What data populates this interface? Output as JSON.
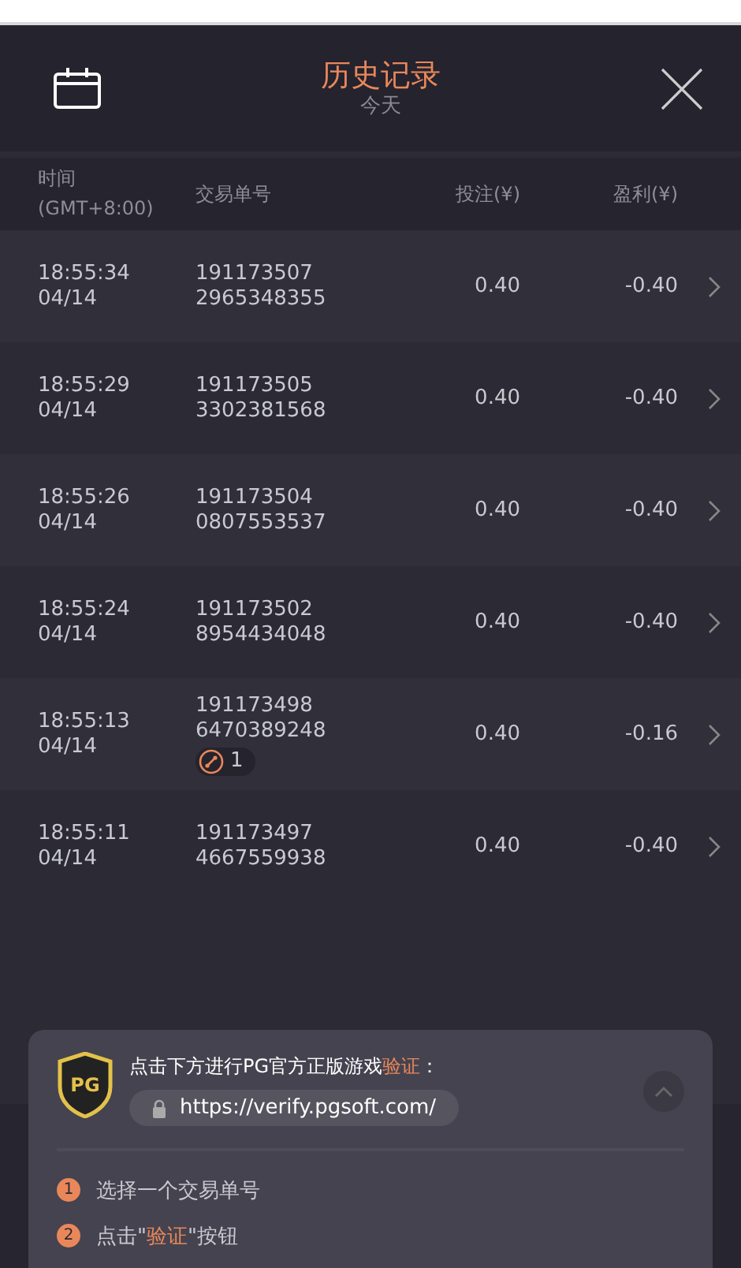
{
  "header": {
    "title": "历史记录",
    "subtitle": "今天"
  },
  "columns": [
    {
      "label": "时间",
      "sublabel": "(GMT+8:00)"
    },
    {
      "label": "交易单号"
    },
    {
      "label": "投注(¥)"
    },
    {
      "label": "盈利(¥)"
    }
  ],
  "rows": [
    {
      "time": "18:55:34",
      "date": "04/14",
      "id_line_1": "191173507",
      "id_line_2": "2965348355",
      "bet": "0.40",
      "profit": "-0.40"
    },
    {
      "time": "18:55:29",
      "date": "04/14",
      "id_line_1": "191173505",
      "id_line_2": "3302381568",
      "bet": "0.40",
      "profit": "-0.40"
    },
    {
      "time": "18:55:26",
      "date": "04/14",
      "id_line_1": "191173504",
      "id_line_2": "0807553537",
      "bet": "0.40",
      "profit": "-0.40"
    },
    {
      "time": "18:55:24",
      "date": "04/14",
      "id_line_1": "191173502",
      "id_line_2": "8954434048",
      "bet": "0.40",
      "profit": "-0.40"
    },
    {
      "time": "18:55:13",
      "date": "04/14",
      "id_line_1": "191173498",
      "id_line_2": "6470389248",
      "bet": "0.40",
      "profit": "-0.16",
      "badge": "1"
    },
    {
      "time": "18:55:11",
      "date": "04/14",
      "id_line_1": "191173497",
      "id_line_2": "4667559938",
      "bet": "0.40",
      "profit": "-0.40"
    }
  ],
  "verify_card": {
    "logo": "PG",
    "prompt": {
      "lead": "点击下方进行PG官方正版游戏",
      "highlight": "验证",
      "trail": "："
    },
    "url": "https://verify.pgsoft.com/",
    "expanded": true,
    "steps": [
      {
        "number": "1",
        "lead": "选择一个交易单号"
      },
      {
        "number": "2",
        "lead": "点击\"",
        "highlight": "验证",
        "trail": "\"按钮"
      }
    ]
  }
}
